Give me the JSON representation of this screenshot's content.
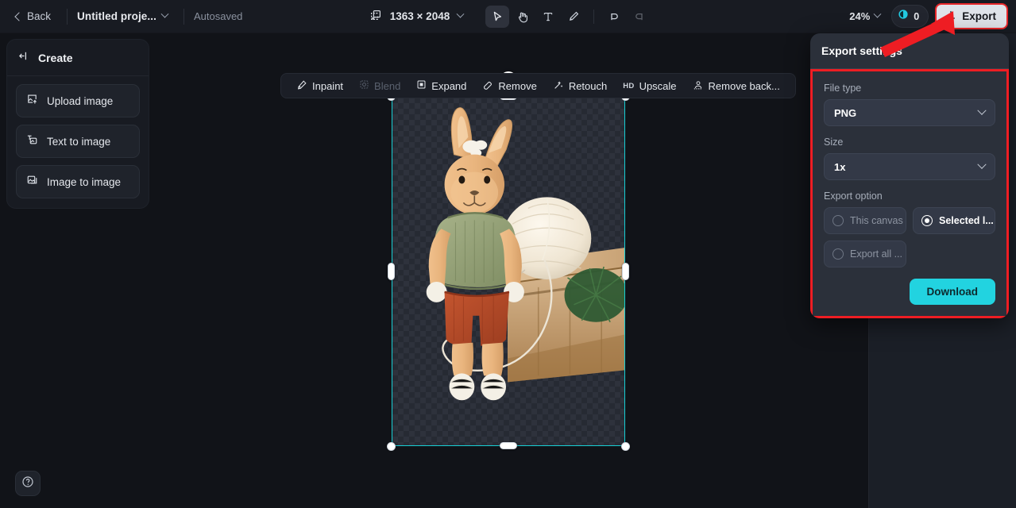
{
  "topbar": {
    "back_label": "Back",
    "project_name": "Untitled proje...",
    "autosaved_label": "Autosaved",
    "canvas_size_label": "1363 × 2048",
    "zoom_label": "24%",
    "credits_count": "0",
    "export_label": "Export",
    "tools": [
      {
        "name": "select-tool",
        "icon": "cursor-icon",
        "active": true,
        "disabled": false
      },
      {
        "name": "hand-tool",
        "icon": "hand-icon",
        "active": false,
        "disabled": false
      },
      {
        "name": "text-tool",
        "icon": "text-icon",
        "active": false,
        "disabled": false
      },
      {
        "name": "brush-tool",
        "icon": "brush-icon",
        "active": false,
        "disabled": false
      },
      {
        "name": "undo-tool",
        "icon": "undo-icon",
        "active": false,
        "disabled": false
      },
      {
        "name": "redo-tool",
        "icon": "redo-icon",
        "active": false,
        "disabled": true
      }
    ]
  },
  "sidebar": {
    "title": "Create",
    "collapse_icon": "collapse-left-icon",
    "items": [
      {
        "label": "Upload image",
        "icon": "upload-image-icon"
      },
      {
        "label": "Text to image",
        "icon": "text-to-image-icon"
      },
      {
        "label": "Image to image",
        "icon": "image-to-image-icon"
      }
    ]
  },
  "float_toolbar": {
    "items": [
      {
        "label": "Inpaint",
        "icon": "inpaint-icon",
        "disabled": false
      },
      {
        "label": "Blend",
        "icon": "blend-icon",
        "disabled": true
      },
      {
        "label": "Expand",
        "icon": "expand-icon",
        "disabled": false
      },
      {
        "label": "Remove",
        "icon": "remove-icon",
        "disabled": false
      },
      {
        "label": "Retouch",
        "icon": "retouch-icon",
        "disabled": false
      },
      {
        "label": "Upscale",
        "icon": "hd-icon",
        "disabled": false
      },
      {
        "label": "Remove back...",
        "icon": "remove-background-icon",
        "disabled": false
      }
    ]
  },
  "canvas": {
    "selection": {
      "rotate_icon": "rotate-icon"
    },
    "artwork_description": "Crocheted amigurumi rabbit doll in green top and red shorts seated beside a ball of cream yarn on a cardboard box with pine sprig, on transparent checkerboard background"
  },
  "export_panel": {
    "title": "Export settings",
    "file_type_label": "File type",
    "file_type_value": "PNG",
    "size_label": "Size",
    "size_value": "1x",
    "export_option_label": "Export option",
    "options": [
      {
        "label": "This canvas",
        "selected": false
      },
      {
        "label": "Selected l...",
        "selected": true
      },
      {
        "label": "Export all ...",
        "selected": false
      }
    ],
    "download_label": "Download"
  },
  "help": {
    "icon": "help-circle-icon"
  },
  "colors": {
    "app_bg": "#111318",
    "panel_bg": "#181b22",
    "popover_bg": "#2b303a",
    "accent_cyan": "#22d3e0",
    "selection_cyan": "#18cfd4",
    "annotation_red": "#ee1d23",
    "export_btn_bg": "#dfe3e9"
  }
}
